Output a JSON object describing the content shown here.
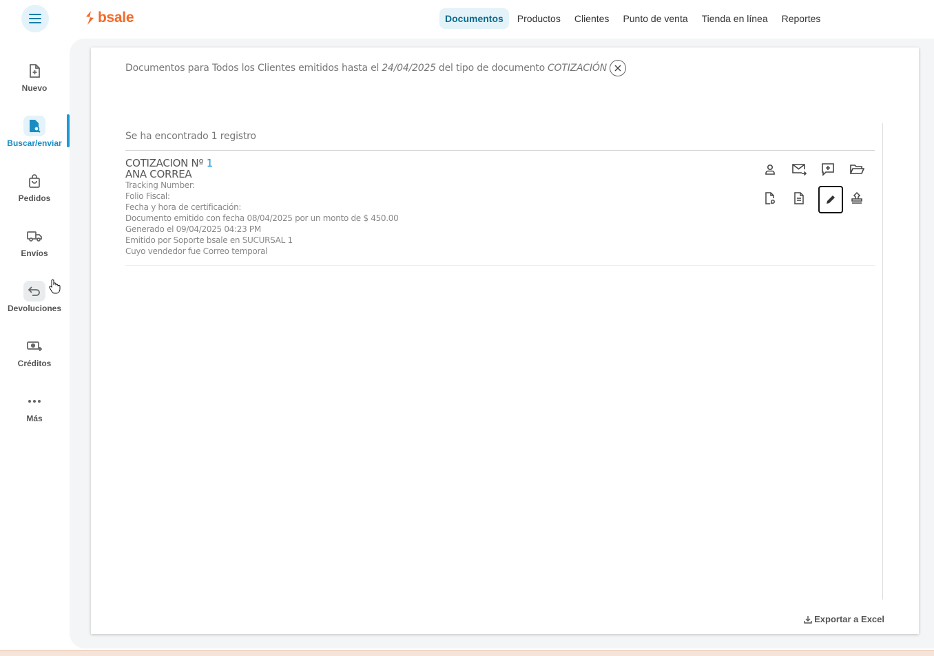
{
  "brand": {
    "name": "bsale",
    "color": "#f26a29",
    "accent": "#1a9ad6"
  },
  "topnav": {
    "items": [
      {
        "label": "Documentos",
        "active": true
      },
      {
        "label": "Productos"
      },
      {
        "label": "Clientes"
      },
      {
        "label": "Punto de venta"
      },
      {
        "label": "Tienda en línea"
      },
      {
        "label": "Reportes"
      }
    ]
  },
  "sidebar": {
    "items": [
      {
        "label": "Nuevo",
        "icon": "new-document-icon"
      },
      {
        "label": "Buscar/enviar",
        "icon": "search-document-icon",
        "active": true
      },
      {
        "label": "Pedidos",
        "icon": "shopping-bag-icon"
      },
      {
        "label": "Envíos",
        "icon": "truck-icon"
      },
      {
        "label": "Devoluciones",
        "icon": "return-arrow-icon"
      },
      {
        "label": "Créditos",
        "icon": "money-plus-icon"
      },
      {
        "label": "Más",
        "icon": "more-dots-icon"
      }
    ]
  },
  "filter": {
    "prefix": "Documentos para Todos los Clientes emitidos hasta el",
    "date": "24/04/2025",
    "middle": "del tipo de documento",
    "doc_type": "COTIZACIÓN"
  },
  "results": {
    "count_text": "Se ha encontrado 1 registro",
    "items": [
      {
        "title": "COTIZACION Nº",
        "number": "1",
        "client": "ANA CORREA",
        "lines": [
          "Tracking Number:",
          "Folio Fiscal:",
          "Fecha y hora de certificación:",
          "Documento emitido con fecha 08/04/2025 por un monto de $ 450.00",
          "Generado el 09/04/2025 04:23 PM",
          "Emitido por Soporte bsale en SUCURSAL 1",
          "Cuyo vendedor fue Correo temporal"
        ],
        "actions": [
          "person-icon",
          "email-forward-icon",
          "comment-plus-icon",
          "folder-open-icon",
          "document-link-icon",
          "document-icon",
          "pencil-icon",
          "stamp-icon"
        ]
      }
    ]
  },
  "export_label": "Exportar a Excel"
}
